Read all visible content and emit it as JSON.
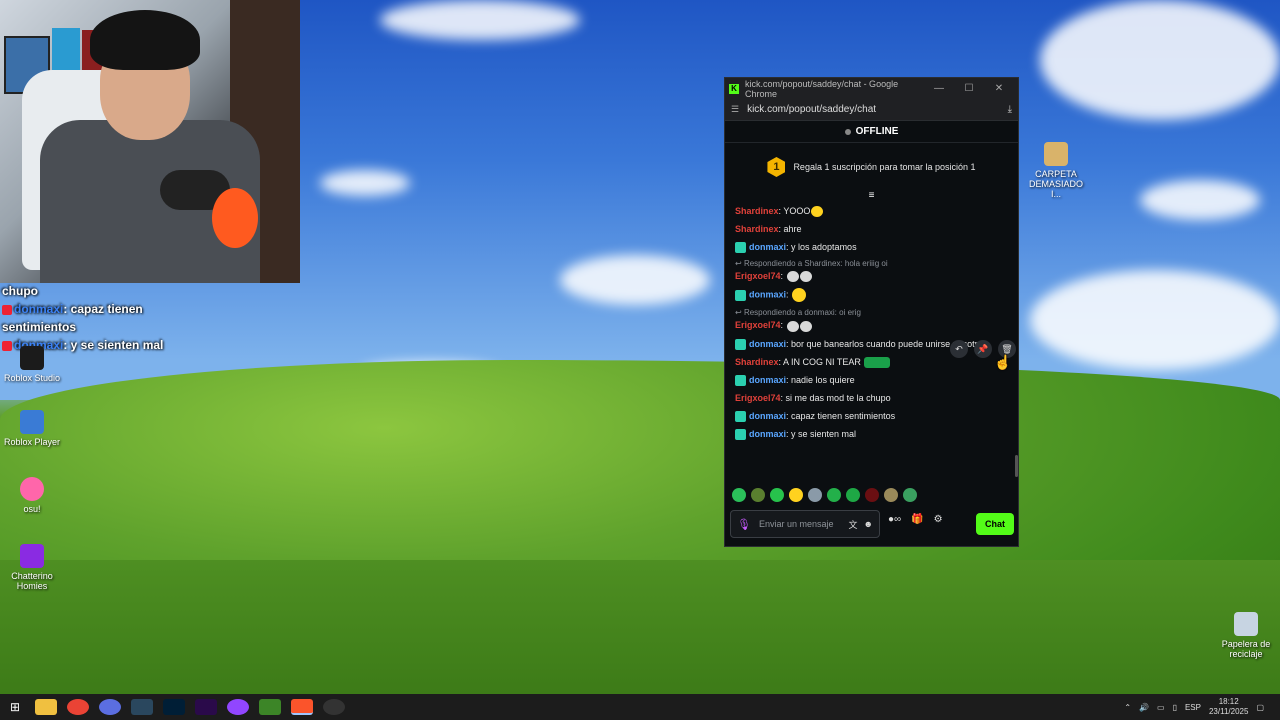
{
  "overlay_chat": {
    "lines": [
      {
        "user": "",
        "text": "chupo"
      },
      {
        "user": "donmaxi",
        "text": ": capaz tienen"
      },
      {
        "user": "",
        "text": "sentimientos"
      },
      {
        "user": "donmaxi",
        "text": ": y se sienten mal"
      }
    ]
  },
  "desktop_icons": [
    {
      "label": "Roblox Studio",
      "color": "#1b1b1b"
    },
    {
      "label": "Roblox Player",
      "color": "#3a7bd5"
    },
    {
      "label": "osu!",
      "color": "#ff66aa"
    },
    {
      "label": "Chatterino Homies",
      "color": "#8a2be2"
    },
    {
      "label": "CARPETA DEMASIADO I...",
      "color": "#d9b36a"
    },
    {
      "label": "Papelera de reciclaje",
      "color": "#c7d4e2"
    }
  ],
  "window": {
    "title": "kick.com/popout/saddey/chat - Google Chrome",
    "url": "kick.com/popout/saddey/chat",
    "status": "OFFLINE",
    "promo_rank": "1",
    "promo_text": "Regala 1 suscripción para tomar la posición 1"
  },
  "messages": [
    {
      "user": "Shardinex",
      "color": "red",
      "text": "YOOO"
    },
    {
      "user": "Shardinex",
      "color": "red",
      "text": "ahre"
    },
    {
      "user": "donmaxi",
      "color": "blue",
      "text": "y los adoptamos"
    },
    {
      "reply": "Respondiendo a Shardinex: hola eriiig oi"
    },
    {
      "user": "Erigxoel74",
      "color": "red",
      "text": ""
    },
    {
      "user": "donmaxi",
      "color": "blue",
      "text": ""
    },
    {
      "reply": "Respondiendo a donmaxi: oi erig"
    },
    {
      "user": "Erigxoel74",
      "color": "red",
      "text": ""
    },
    {
      "user": "donmaxi",
      "color": "blue",
      "text": "bor que banearlos cuando puede unirse nosotros"
    },
    {
      "user": "Shardinex",
      "color": "red",
      "text": "A IN COG NI TEAR"
    },
    {
      "user": "donmaxi",
      "color": "blue",
      "text": "nadie los quiere"
    },
    {
      "user": "Erigxoel74",
      "color": "red",
      "text": "si me das mod te la chupo"
    },
    {
      "user": "donmaxi",
      "color": "blue",
      "text": "capaz tienen sentimientos"
    },
    {
      "user": "donmaxi",
      "color": "blue",
      "text": "y se sienten mal"
    }
  ],
  "input": {
    "placeholder": "Enviar un mensaje",
    "chat_button": "Chat"
  },
  "taskbar": {
    "language": "ESP",
    "time": "18:12",
    "date": "23/11/2025"
  },
  "colors": {
    "kick_green": "#53fc18",
    "user_red": "#e0413a",
    "user_blue": "#5aa6ff"
  }
}
